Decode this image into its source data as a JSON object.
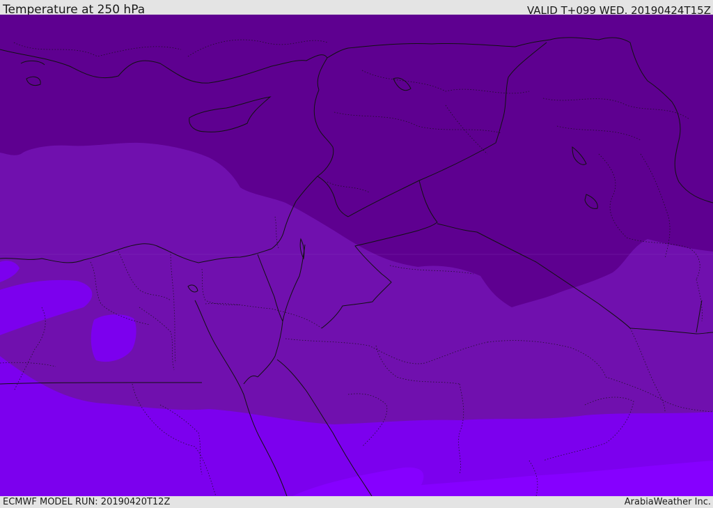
{
  "header": {
    "title": "Temperature at 250 hPa",
    "valid_time": "VALID T+099 WED. 20190424T15Z"
  },
  "footer": {
    "model_run": "ECMWF MODEL RUN: 20190420T12Z",
    "credit": "ArabiaWeather Inc."
  },
  "map": {
    "colors": {
      "band_coldest": "#5e0090",
      "band_cold": "#7010ae",
      "band_mid": "#7a00d8",
      "band_warm": "#7c00ee",
      "band_warmest": "#8600ff",
      "borders": "#111111"
    }
  }
}
